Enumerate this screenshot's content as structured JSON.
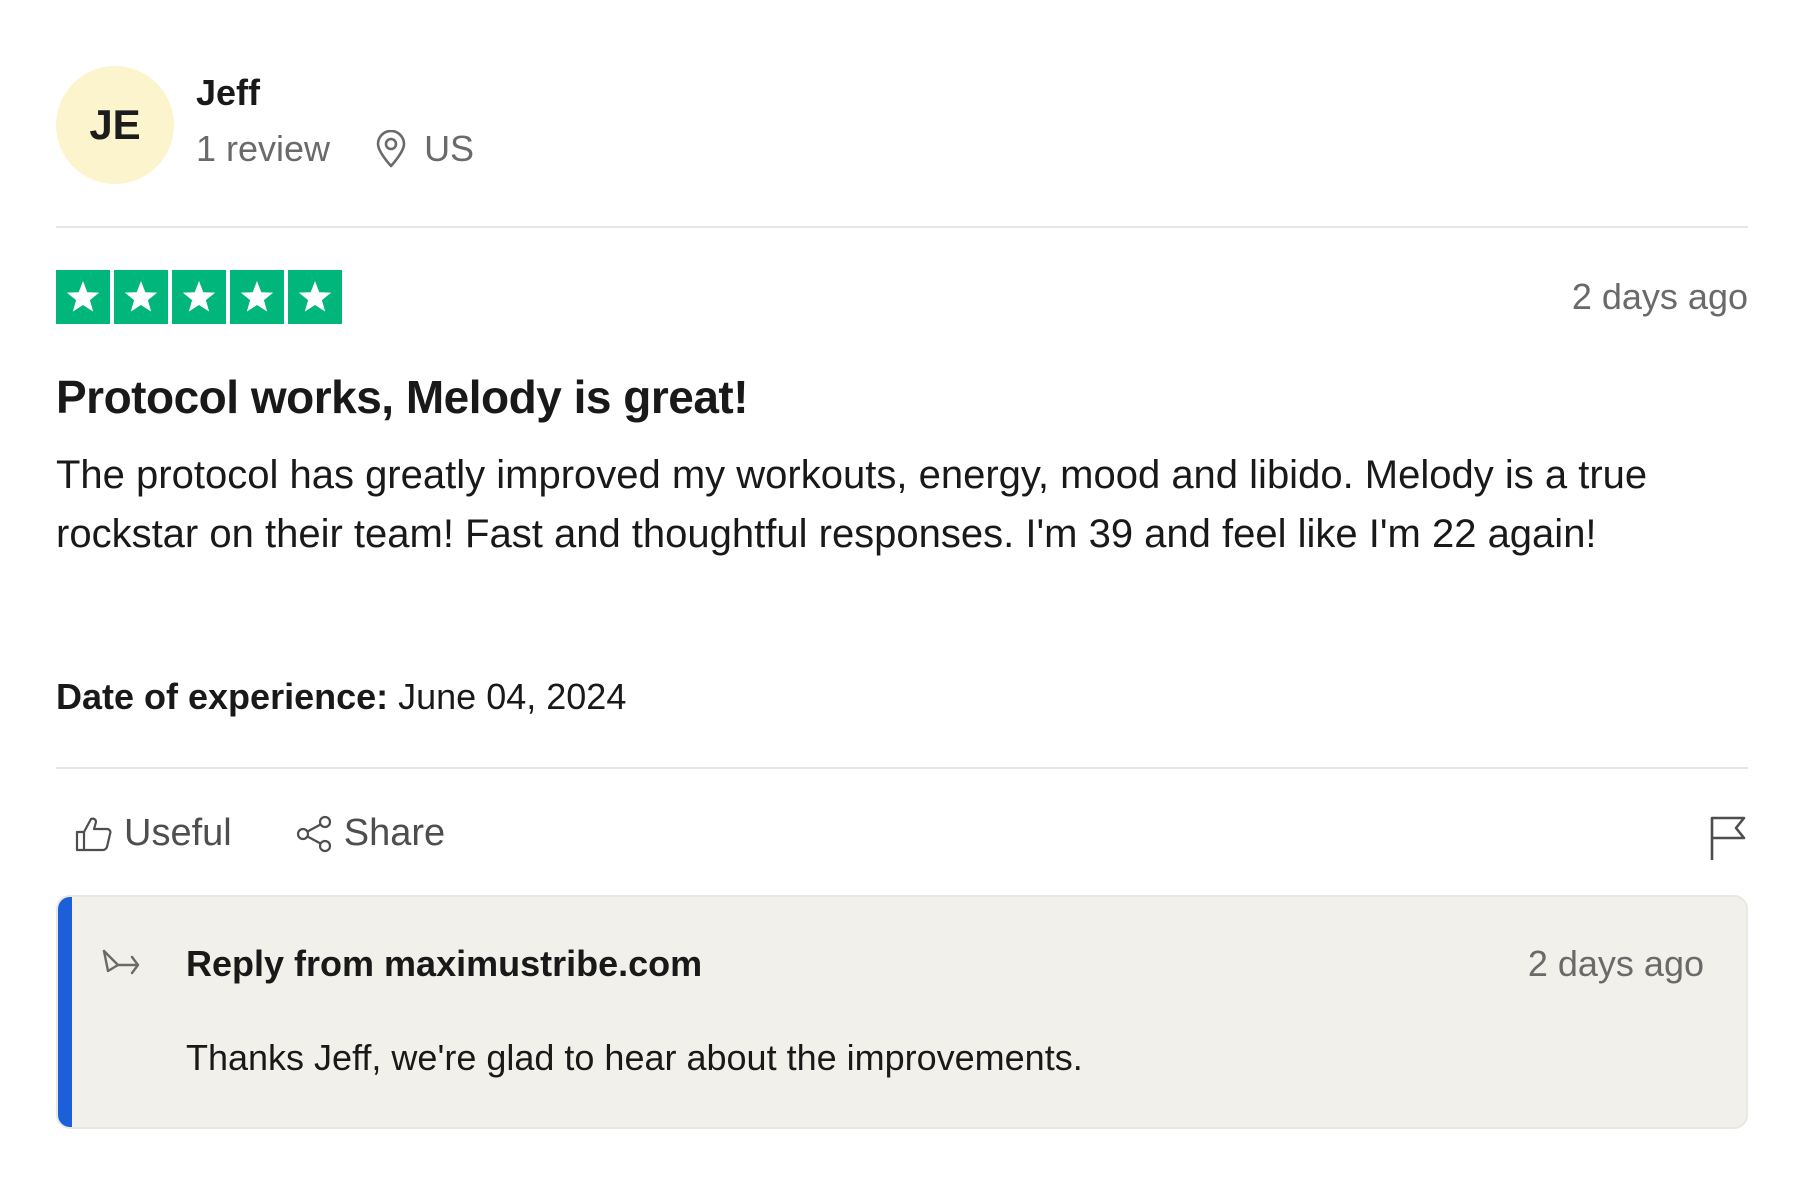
{
  "reviewer": {
    "initials": "JE",
    "name": "Jeff",
    "review_count": "1 review",
    "location_icon": "map-pin-icon",
    "country": "US",
    "avatar_color": "#fbf4cc"
  },
  "review": {
    "rating": 5,
    "max_rating": 5,
    "star_color": "#00b67a",
    "date": "2 days ago",
    "title": "Protocol works, Melody is great!",
    "body": "The protocol has greatly improved my workouts, energy, mood and libido. Melody is a true rockstar on their team! Fast and thoughtful responses. I'm 39 and feel like I'm 22 again!",
    "experience_label": "Date of experience:",
    "experience_date": "June 04, 2024"
  },
  "actions": {
    "useful_label": "Useful",
    "useful_icon": "thumbs-up-icon",
    "share_label": "Share",
    "share_icon": "share-icon",
    "flag_icon": "flag-icon"
  },
  "reply": {
    "icon": "reply-arrow-icon",
    "title": "Reply from maximustribe.com",
    "date": "2 days ago",
    "text": "Thanks Jeff, we're glad to hear about the improvements.",
    "accent_color": "#1c5fd9"
  }
}
